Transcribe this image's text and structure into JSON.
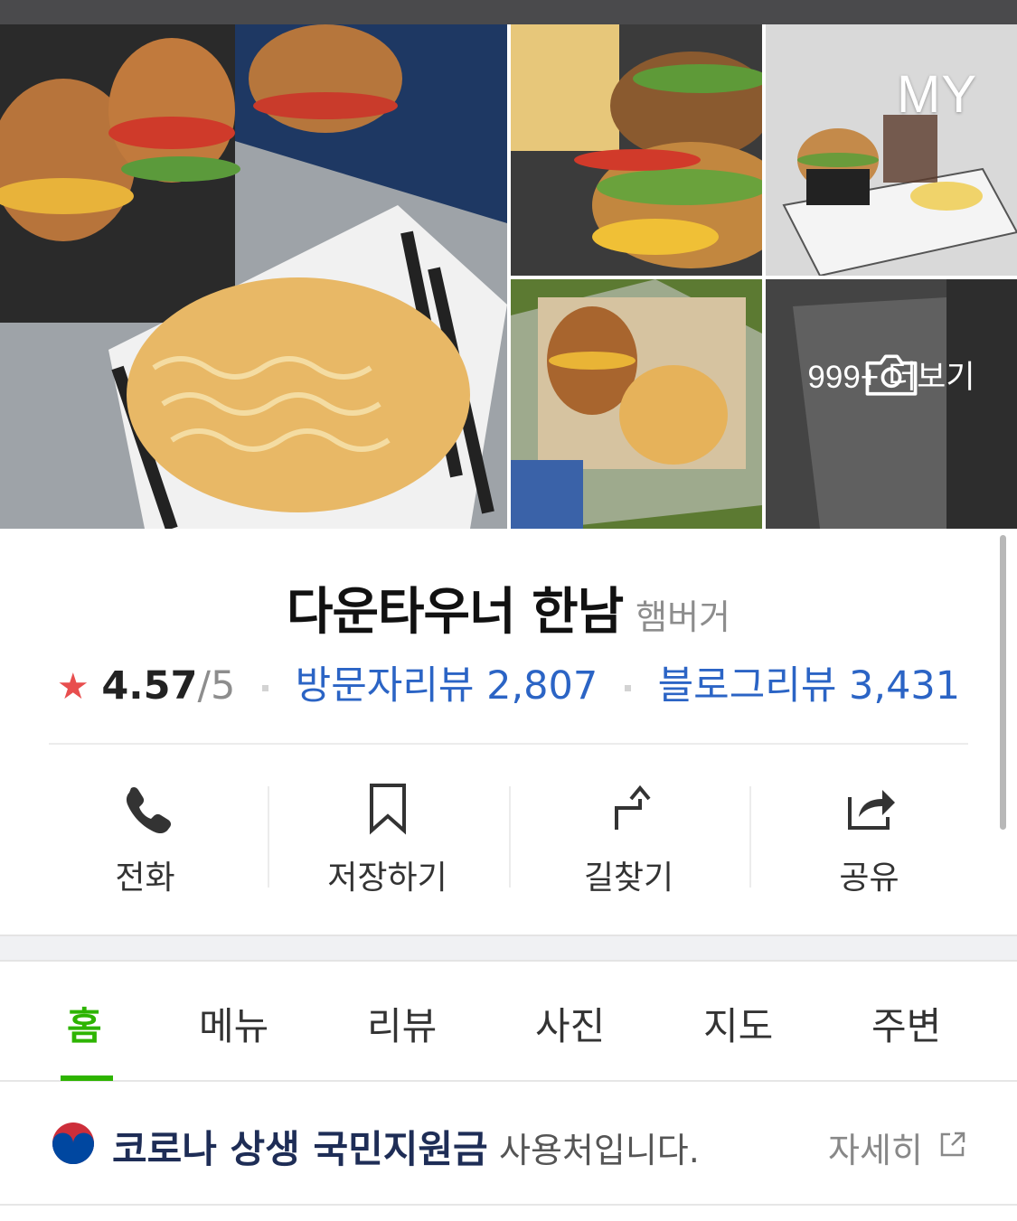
{
  "gallery": {
    "my_label": "MY",
    "more_label": "999+ 더보기"
  },
  "place": {
    "name": "다운타우너 한남",
    "category": "햄버거",
    "rating_star": "★",
    "rating": "4.57",
    "rating_max": "/5",
    "visitor_reviews": "방문자리뷰 2,807",
    "blog_reviews": "블로그리뷰 3,431"
  },
  "actions": [
    {
      "label": "전화",
      "icon": "phone-icon"
    },
    {
      "label": "저장하기",
      "icon": "bookmark-icon"
    },
    {
      "label": "길찾기",
      "icon": "directions-icon"
    },
    {
      "label": "공유",
      "icon": "share-icon"
    }
  ],
  "tabs": [
    {
      "label": "홈",
      "active": true
    },
    {
      "label": "메뉴"
    },
    {
      "label": "리뷰"
    },
    {
      "label": "사진"
    },
    {
      "label": "지도"
    },
    {
      "label": "주변"
    }
  ],
  "notice": {
    "highlight": "코로나 상생 국민지원금",
    "text": "사용처입니다.",
    "link": "자세히"
  },
  "colors": {
    "accent_green": "#2db400",
    "link_blue": "#2b64c5",
    "star_red": "#e84e4e",
    "notice_navy": "#1e2d56"
  }
}
